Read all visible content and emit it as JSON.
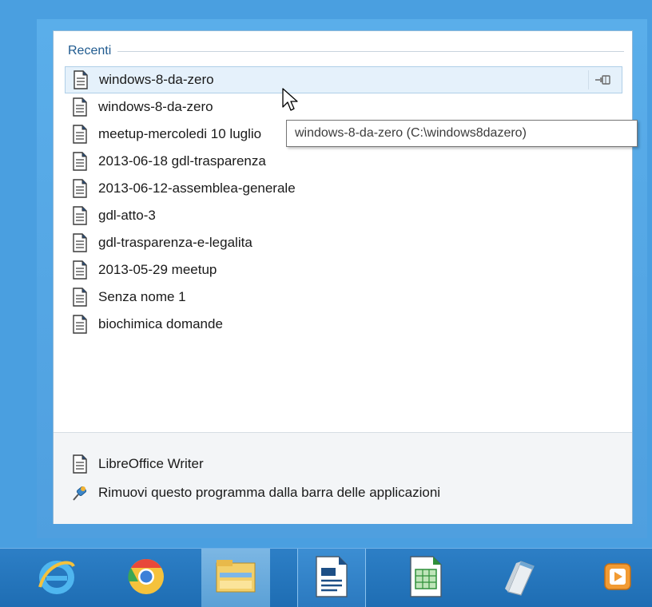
{
  "jumplist": {
    "recent_header": "Recenti",
    "recent_items": [
      {
        "label": "windows-8-da-zero",
        "icon": "document-icon",
        "hovered": true
      },
      {
        "label": "windows-8-da-zero",
        "icon": "document-icon"
      },
      {
        "label": "meetup-mercoledi 10 luglio",
        "icon": "document-icon"
      },
      {
        "label": "2013-06-18 gdl-trasparenza",
        "icon": "document-icon"
      },
      {
        "label": "2013-06-12-assemblea-generale",
        "icon": "document-icon"
      },
      {
        "label": "gdl-atto-3",
        "icon": "document-icon"
      },
      {
        "label": "gdl-trasparenza-e-legalita",
        "icon": "document-icon"
      },
      {
        "label": "2013-05-29 meetup",
        "icon": "document-icon"
      },
      {
        "label": "Senza nome 1",
        "icon": "document-icon"
      },
      {
        "label": "biochimica domande",
        "icon": "document-icon"
      }
    ],
    "pin_icon": "pin-icon",
    "tasks": [
      {
        "label": "LibreOffice Writer",
        "icon": "document-icon"
      },
      {
        "label": "Rimuovi questo programma dalla barra delle applicazioni",
        "icon": "unpin-icon"
      }
    ]
  },
  "tooltip": {
    "text": "windows-8-da-zero (C:\\windows8dazero)"
  },
  "taskbar": {
    "buttons": [
      {
        "name": "internet-explorer-icon"
      },
      {
        "name": "chrome-icon"
      },
      {
        "name": "file-explorer-icon"
      },
      {
        "name": "libreoffice-writer-icon"
      },
      {
        "name": "libreoffice-calc-icon"
      },
      {
        "name": "notepad-icon"
      },
      {
        "name": "media-app-icon"
      }
    ]
  },
  "colors": {
    "accent": "#1f5a8f",
    "taskbar": "#2472b8",
    "hover_bg": "#e5f1fb"
  }
}
